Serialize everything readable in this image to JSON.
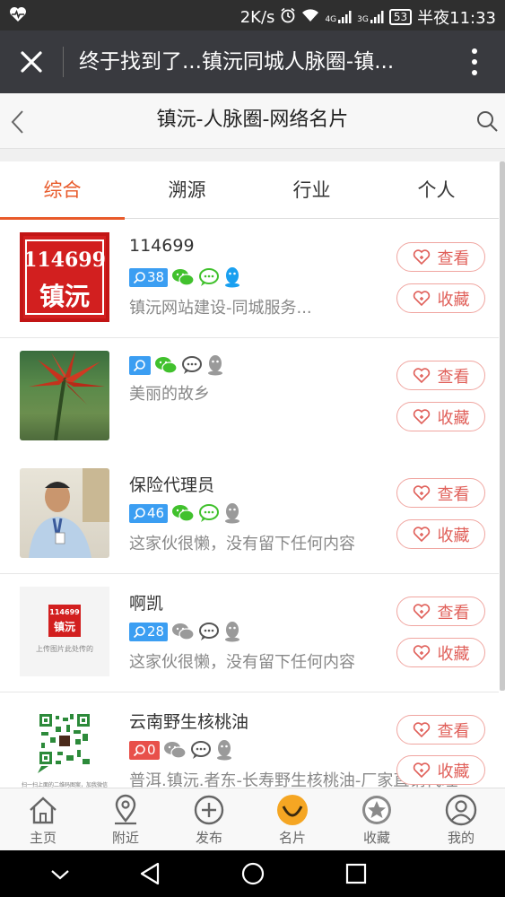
{
  "status_bar": {
    "network_speed": "2K/s",
    "signal_4g": "4G",
    "signal_3g": "3G",
    "battery": "53",
    "time": "半夜11:33"
  },
  "title_bar": {
    "title": "终于找到了...镇沅同城人脉圈-镇..."
  },
  "page_header": {
    "title": "镇沅-人脉圈-网络名片"
  },
  "tabs": [
    {
      "label": "综合",
      "active": true
    },
    {
      "label": "溯源",
      "active": false
    },
    {
      "label": "行业",
      "active": false
    },
    {
      "label": "个人",
      "active": false
    }
  ],
  "cards": [
    {
      "name": "114699",
      "count": "38",
      "badge_color": "blue",
      "wechat": "green",
      "moments": "green",
      "qq": "blue",
      "desc": "镇沅网站建设-同城服务...",
      "thumb": "seal",
      "thumb_text1": "114699",
      "thumb_text2": "镇沅"
    },
    {
      "name": "",
      "count": "",
      "badge_color": "blue",
      "wechat": "green",
      "moments": "gray",
      "qq": "gray",
      "desc": "美丽的故乡",
      "thumb": "flower"
    },
    {
      "name": "保险代理员",
      "count": "46",
      "badge_color": "blue",
      "wechat": "green",
      "moments": "green",
      "qq": "gray",
      "desc": "这家伙很懒，没有留下任何内容",
      "thumb": "person"
    },
    {
      "name": "啊凯",
      "count": "28",
      "badge_color": "blue",
      "wechat": "gray",
      "moments": "gray",
      "qq": "gray",
      "desc": "这家伙很懒，没有留下任何内容",
      "thumb": "seal_small",
      "thumb_text1": "114699",
      "thumb_text2": "镇沅",
      "thumb_caption": "上传图片此处传的"
    },
    {
      "name": "云南野生核桃油",
      "count": "0",
      "badge_color": "red",
      "wechat": "gray",
      "moments": "gray",
      "qq": "gray",
      "desc": "普洱.镇沅.者东-长寿野生核桃油-厂家直销代理",
      "thumb": "qrcode",
      "thumb_caption": "扫一扫上面的二维码图案，加我微信"
    }
  ],
  "buttons": {
    "view": "查看",
    "favorite": "收藏"
  },
  "bottom_nav": [
    {
      "label": "主页",
      "icon": "home-icon",
      "active": false
    },
    {
      "label": "附近",
      "icon": "location-icon",
      "active": false
    },
    {
      "label": "发布",
      "icon": "plus-circle-icon",
      "active": false
    },
    {
      "label": "名片",
      "icon": "smile-icon",
      "active": true
    },
    {
      "label": "收藏",
      "icon": "star-icon",
      "active": false
    },
    {
      "label": "我的",
      "icon": "user-icon",
      "active": false
    }
  ],
  "colors": {
    "accent": "#e85a2a",
    "button_border": "#f0a5a0",
    "button_text": "#e0605a",
    "badge_blue": "#3b9ef2",
    "badge_red": "#e8504a",
    "wechat_green": "#41c12d",
    "qq_blue": "#1aa0f0",
    "nav_active": "#f5a623"
  }
}
